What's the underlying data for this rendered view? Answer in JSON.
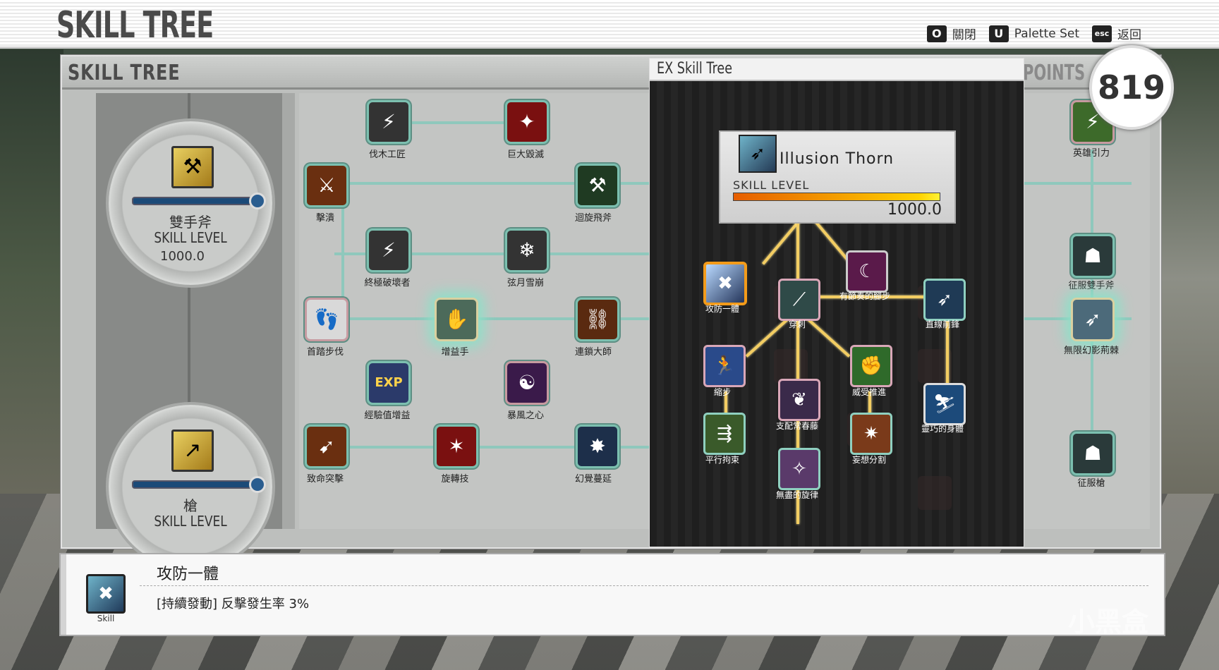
{
  "header": {
    "title": "SKILL TREE",
    "keys": [
      {
        "key": "O",
        "label": "關閉"
      },
      {
        "key": "U",
        "label": "Palette Set"
      },
      {
        "key": "esc",
        "label": "返回"
      }
    ]
  },
  "panel": {
    "title": "SKILL TREE",
    "points_label": "POINTS",
    "points_value": "819"
  },
  "weapons": [
    {
      "name": "雙手斧",
      "level_label": "SKILL LEVEL",
      "level_value": "1000.0"
    },
    {
      "name": "槍",
      "level_label": "SKILL LEVEL",
      "level_value": ""
    }
  ],
  "tree_nodes": [
    "伐木工匠",
    "巨大毀滅",
    "擊潰",
    "迴旋飛斧",
    "終極破壞者",
    "弦月雪崩",
    "首踏步伐",
    "增益手",
    "連鎖大師",
    "經驗值增益",
    "暴風之心",
    "致命突擊",
    "旋轉技",
    "幻覺蔓延",
    "英雄引力",
    "征服雙手斧",
    "無限幻影荊棘",
    "征服槍"
  ],
  "ex": {
    "title": "EX Skill Tree",
    "skill_name": "Illusion Thorn",
    "skill_level_label": "SKILL LEVEL",
    "skill_level_value": "1000.0",
    "nodes": [
      "攻防一體",
      "有節奏的腳步",
      "穿刺",
      "直線前鋒",
      "縮步",
      "威受推進",
      "靈巧的身體",
      "支配常春藤",
      "平行拘束",
      "妄想分割",
      "無盡的旋律"
    ]
  },
  "detail": {
    "name": "攻防一體",
    "category": "Skill",
    "description": "[持續發動] 反擊發生率 3%"
  },
  "watermark": "小黑盒",
  "colors": {
    "gold_line": "#f3cd62",
    "tree_line": "#8fc8bc",
    "level_bar_start": "#e65d00",
    "level_bar_end": "#ffd200"
  }
}
